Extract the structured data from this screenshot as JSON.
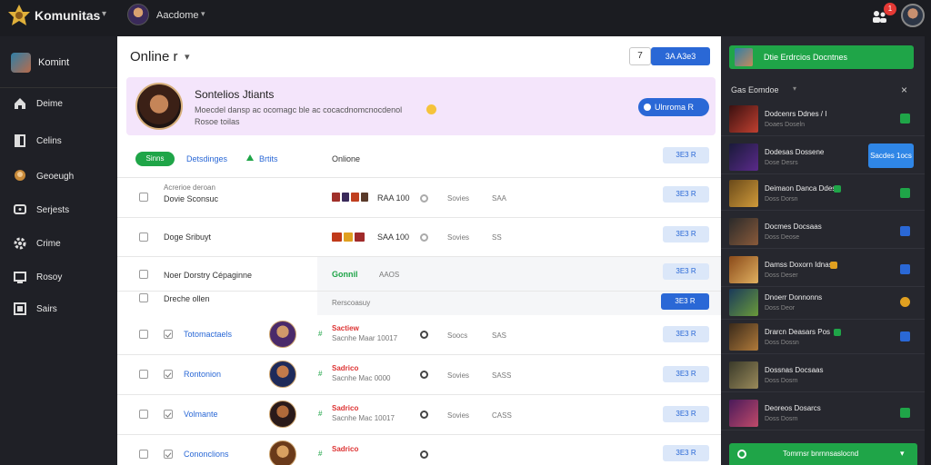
{
  "app": {
    "brand": "Komunitas",
    "user": "Aacdome",
    "notification_count": "1",
    "colors": {
      "accent": "#2a68d6",
      "online": "#1fa548",
      "background": "#1b1c21",
      "banner": "#f4e5fb"
    }
  },
  "nav": {
    "profile_label": "Komint",
    "items": [
      {
        "label": "Deime",
        "icon": "home-icon"
      },
      {
        "label": "Celins",
        "icon": "door-icon"
      },
      {
        "label": "Geoeugh",
        "icon": "character-icon"
      },
      {
        "label": "Serjests",
        "icon": "chat-icon"
      },
      {
        "label": "Crime",
        "icon": "gear-icon"
      },
      {
        "label": "Rosoy",
        "icon": "monitor-icon"
      },
      {
        "label": "Sairs",
        "icon": "box-icon"
      }
    ]
  },
  "main": {
    "title": "Online r",
    "top_outline_btn": "7",
    "top_primary_btn": "3A A3e3",
    "banner": {
      "title": "Sontelios Jtiants",
      "line1": "Moecdel dansp ac ocomagc ble ac cocacdnomcnocdenol",
      "line2": "Rosoe toilas",
      "button": "Ulnroma R"
    },
    "filters": {
      "chip": "Sinns",
      "link1": "Detsdinges",
      "link2": "Brtits",
      "label": "Onlione"
    },
    "row_button": "3E3 R",
    "rows": [
      {
        "top": "Acrerioe deroan",
        "name": "Dovie Sconsuc",
        "num": "RAA 100",
        "c1": "Sovies",
        "c2": "SAA"
      },
      {
        "name": "Doge Sribuyt",
        "num": "SAA 100",
        "c1": "Sovies",
        "c2": "SS"
      },
      {
        "name": "Noer Dorstry Cépaginne",
        "game": "Gonnil",
        "num": "AAOS"
      },
      {
        "name": "Dreche ollen",
        "label": "Rerscoasuy"
      },
      {
        "name": "Totomactaels",
        "tag": "Sactiew",
        "sub": "Sacnhe Maar 10017",
        "c1": "Soocs",
        "c2": "SAS"
      },
      {
        "name": "Rontonion",
        "tag": "Sadrico",
        "sub": "Sacnhe Mac 0000",
        "c1": "Sovies",
        "c2": "SASS"
      },
      {
        "name": "Volmante",
        "tag": "Sadrico",
        "sub": "Sacnhe Mac 10017",
        "c1": "Sovies",
        "c2": "CASS"
      },
      {
        "name": "Cononclions",
        "tag": "Sadrico",
        "sub": "",
        "c1": "",
        "c2": ""
      }
    ]
  },
  "right": {
    "top_label": "Dtie Erdrcios Docntnes",
    "section_title": "Gas Eomdoe",
    "call_button": "Sacdes 1ocs",
    "items": [
      {
        "t1": "Dodcenrs Ddnes / I",
        "t2": "Doaes Doseln",
        "act": "#1fa548"
      },
      {
        "t1": "Dodesas Dossene",
        "t2": "Dose Desrs",
        "act": ""
      },
      {
        "t1": "Deimaon Danca Ddes",
        "t2": "Doss Dorsn",
        "act": "#1fa548"
      },
      {
        "t1": "Docmes Docsaas",
        "t2": "Doss Deose",
        "act": "#2a68d6"
      },
      {
        "t1": "Damss Doxorn Idnas",
        "t2": "Doss Deser",
        "act": "#2a68d6"
      },
      {
        "t1": "Dnoerr Donnonns",
        "t2": "Doss Deor",
        "act": "#e0a020"
      },
      {
        "t1": "Drarcn Deasars Pos",
        "t2": "Doss Dossn",
        "act": "#2a68d6"
      },
      {
        "t1": "Dossnas Docsaas",
        "t2": "Doss Dosrn",
        "act": ""
      },
      {
        "t1": "Deoreos Dosarcs",
        "t2": "Doss Dosrn",
        "act": "#1fa548"
      }
    ],
    "bottom_label": "Tomrnsr bnrnnsaslocnd"
  }
}
